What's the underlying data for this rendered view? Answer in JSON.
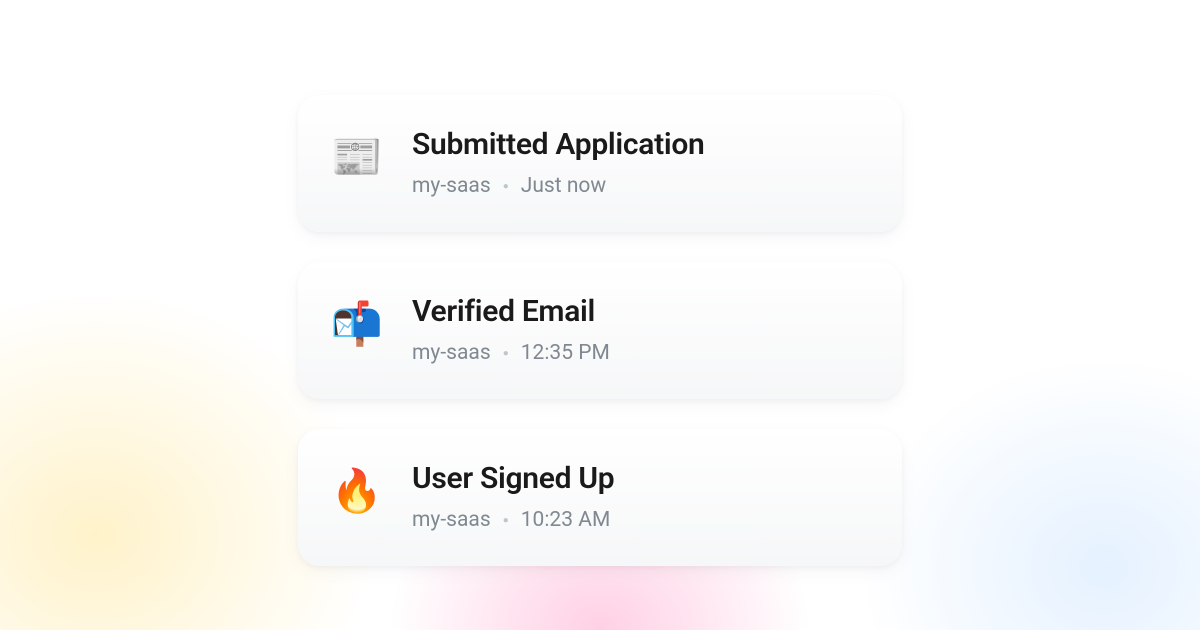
{
  "events": [
    {
      "icon": "📰",
      "icon_name": "newspaper-icon",
      "title": "Submitted Application",
      "project": "my-saas",
      "time": "Just now"
    },
    {
      "icon": "📬",
      "icon_name": "mailbox-icon",
      "title": "Verified Email",
      "project": "my-saas",
      "time": "12:35 PM"
    },
    {
      "icon": "🔥",
      "icon_name": "fire-icon",
      "title": "User Signed Up",
      "project": "my-saas",
      "time": "10:23 AM"
    }
  ]
}
